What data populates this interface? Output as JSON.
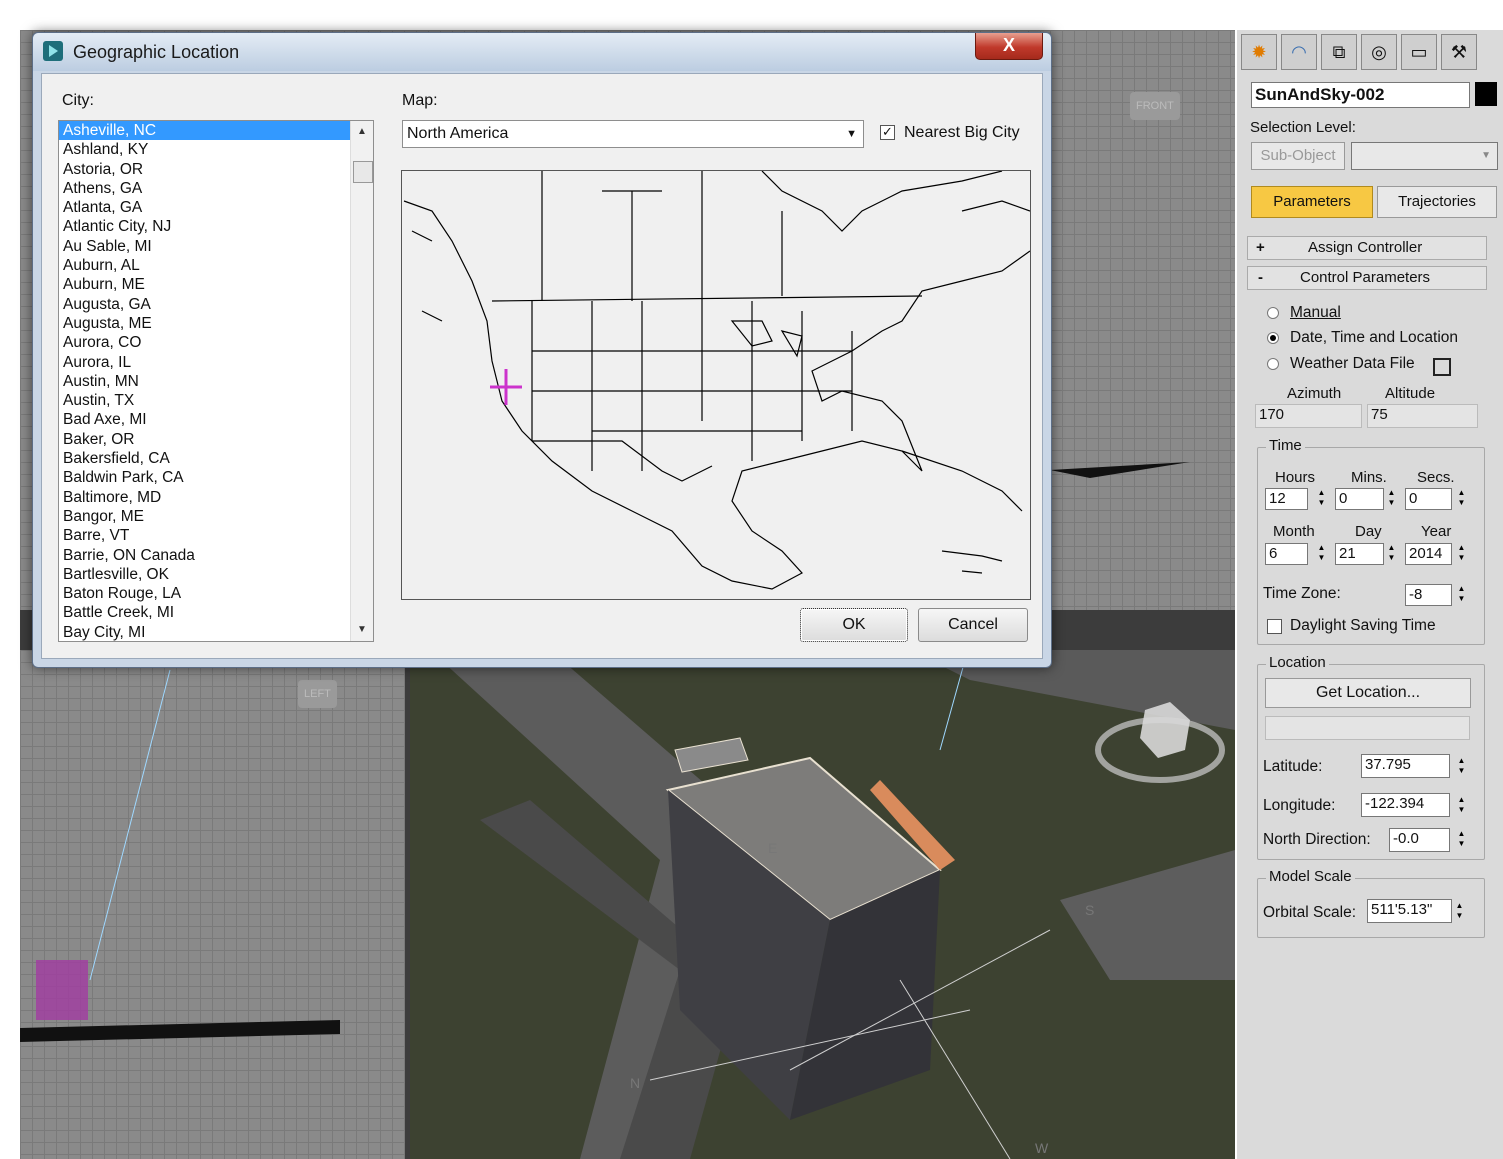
{
  "dialog": {
    "title": "Geographic Location",
    "close_label": "X",
    "city_label": "City:",
    "map_label": "Map:",
    "map_selected": "North America",
    "nearest_big_city_label": "Nearest Big City",
    "nearest_big_city_checked": true,
    "ok_label": "OK",
    "cancel_label": "Cancel",
    "cities": [
      "Asheville, NC",
      "Ashland, KY",
      "Astoria, OR",
      "Athens, GA",
      "Atlanta, GA",
      "Atlantic City, NJ",
      "Au Sable, MI",
      "Auburn, AL",
      "Auburn, ME",
      "Augusta, GA",
      "Augusta, ME",
      "Aurora, CO",
      "Aurora, IL",
      "Austin, MN",
      "Austin, TX",
      "Bad Axe, MI",
      "Baker, OR",
      "Bakersfield, CA",
      "Baldwin Park, CA",
      "Baltimore, MD",
      "Bangor, ME",
      "Barre, VT",
      "Barrie, ON Canada",
      "Bartlesville, OK",
      "Baton Rouge, LA",
      "Battle Creek, MI",
      "Bay City, MI"
    ],
    "selected_city": "Asheville, NC"
  },
  "viewports": {
    "front_label": "FRONT",
    "left_label": "LEFT",
    "compass": [
      "E",
      "S",
      "N",
      "W"
    ]
  },
  "panel": {
    "object_name": "SunAndSky-002",
    "selection_level_label": "Selection Level:",
    "sub_object_label": "Sub-Object",
    "tab_parameters": "Parameters",
    "tab_trajectories": "Trajectories",
    "assign_controller": "Assign Controller",
    "assign_controller_sign": "+",
    "control_parameters": "Control Parameters",
    "control_parameters_sign": "-",
    "mode_manual": "Manual",
    "mode_date_time_location": "Date, Time and Location",
    "mode_weather_data_file": "Weather Data File",
    "selected_mode": "Date, Time and Location",
    "azimuth_label": "Azimuth",
    "altitude_label": "Altitude",
    "azimuth_value": "170",
    "altitude_value": "75",
    "time_group": "Time",
    "hours_label": "Hours",
    "mins_label": "Mins.",
    "secs_label": "Secs.",
    "hours": "12",
    "mins": "0",
    "secs": "0",
    "month_label": "Month",
    "day_label": "Day",
    "year_label": "Year",
    "month": "6",
    "day": "21",
    "year": "2014",
    "time_zone_label": "Time Zone:",
    "time_zone": "-8",
    "daylight_saving_label": "Daylight Saving Time",
    "daylight_saving_checked": false,
    "location_group": "Location",
    "get_location_label": "Get Location...",
    "location_name": "",
    "latitude_label": "Latitude:",
    "latitude": "37.795",
    "longitude_label": "Longitude:",
    "longitude": "-122.394",
    "north_direction_label": "North Direction:",
    "north_direction": "-0.0",
    "model_scale_group": "Model Scale",
    "orbital_scale_label": "Orbital Scale:",
    "orbital_scale": "511'5.13\"",
    "tab_icons": [
      "create-icon",
      "modify-icon",
      "hierarchy-icon",
      "motion-icon",
      "display-icon",
      "utilities-icon"
    ],
    "highlight_color": "#f7c843"
  },
  "colors": {
    "selection": "#3399ff",
    "marker": "#cc33cc"
  }
}
